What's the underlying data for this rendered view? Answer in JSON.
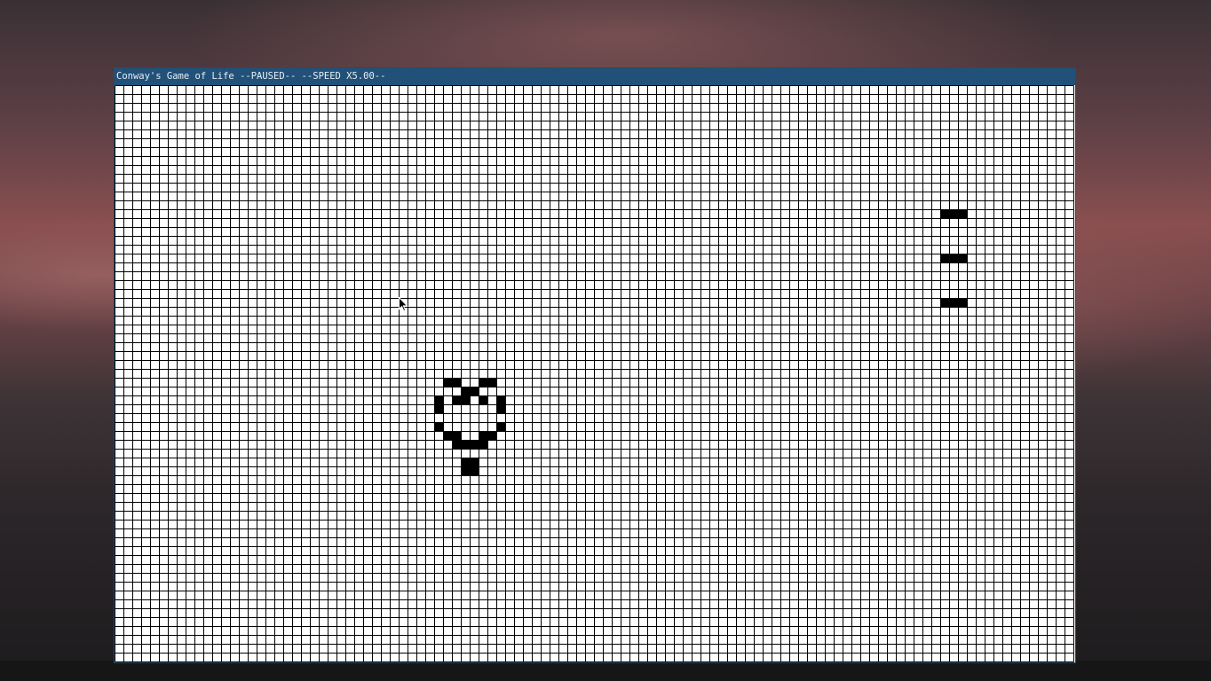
{
  "window": {
    "title": "Conway's Game of Life --PAUSED-- --SPEED X5.00--"
  },
  "grid": {
    "columns": 108,
    "rows": 65,
    "grid_line_color": "#000000",
    "dead_cell_color": "#ffffff",
    "live_cell_color": "#000000",
    "live_cells": [
      [
        93,
        14
      ],
      [
        94,
        14
      ],
      [
        95,
        14
      ],
      [
        93,
        19
      ],
      [
        94,
        19
      ],
      [
        95,
        19
      ],
      [
        93,
        24
      ],
      [
        94,
        24
      ],
      [
        95,
        24
      ],
      [
        37,
        33
      ],
      [
        38,
        33
      ],
      [
        41,
        33
      ],
      [
        42,
        33
      ],
      [
        39,
        34
      ],
      [
        40,
        34
      ],
      [
        36,
        35
      ],
      [
        38,
        35
      ],
      [
        39,
        35
      ],
      [
        41,
        35
      ],
      [
        43,
        35
      ],
      [
        36,
        36
      ],
      [
        43,
        36
      ],
      [
        36,
        38
      ],
      [
        43,
        38
      ],
      [
        37,
        39
      ],
      [
        38,
        39
      ],
      [
        41,
        39
      ],
      [
        42,
        39
      ],
      [
        38,
        40
      ],
      [
        39,
        40
      ],
      [
        40,
        40
      ],
      [
        41,
        40
      ],
      [
        39,
        42
      ],
      [
        40,
        42
      ],
      [
        39,
        43
      ],
      [
        40,
        43
      ]
    ]
  },
  "colors": {
    "titlebar": "#215178",
    "titlebar_text": "#e8eef4"
  },
  "icons": {
    "cursor": "mouse-pointer-icon"
  }
}
